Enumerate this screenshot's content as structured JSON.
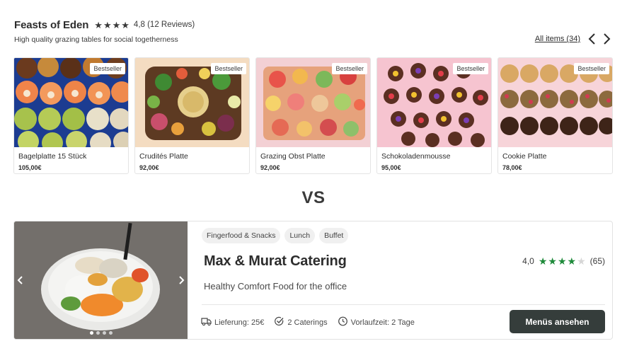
{
  "store": {
    "title": "Feasts of Eden",
    "rating": "4,8 (12 Reviews)",
    "star_count": 4,
    "subtitle": "High quality grazing tables for social togetherness",
    "all_items": "All items (34)",
    "products": [
      {
        "name": "Bagelplatte 15 Stück",
        "price": "105,00€",
        "badge": "Bestseller"
      },
      {
        "name": "Crudités Platte",
        "price": "92,00€",
        "badge": "Bestseller"
      },
      {
        "name": "Grazing Obst Platte",
        "price": "92,00€",
        "badge": "Bestseller"
      },
      {
        "name": "Schokoladenmousse",
        "price": "95,00€",
        "badge": "Bestseller"
      },
      {
        "name": "Cookie Platte",
        "price": "78,00€",
        "badge": "Bestseller"
      }
    ]
  },
  "vs_label": "VS",
  "caterer": {
    "tags": [
      "Fingerfood & Snacks",
      "Lunch",
      "Buffet"
    ],
    "name": "Max & Murat Catering",
    "rating_value": "4,0",
    "rating_count": "(65)",
    "stars_filled": 4,
    "stars_total": 5,
    "tagline": "Healthy Comfort Food for the office",
    "delivery": "Lieferung: 25€",
    "caterings": "2 Caterings",
    "lead_time": "Vorlaufzeit: 2 Tage",
    "cta": "Menüs ansehen",
    "carousel_dots": 4,
    "active_dot": 0
  },
  "colors": {
    "accent_green": "#1e8a3a",
    "button_dark": "#353d3b"
  },
  "icons": [
    "star-icon",
    "chevron-left-icon",
    "chevron-right-icon",
    "truck-icon",
    "check-circle-icon",
    "clock-icon"
  ]
}
